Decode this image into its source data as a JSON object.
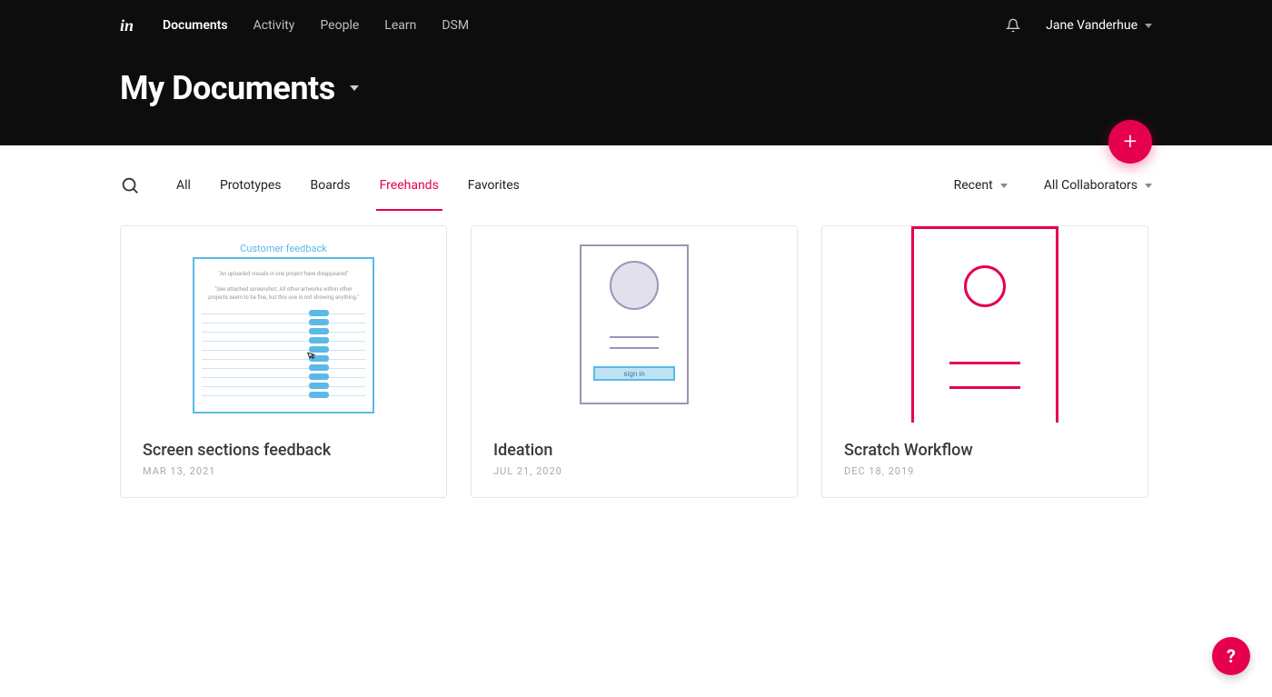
{
  "nav": {
    "links": [
      "Documents",
      "Activity",
      "People",
      "Learn",
      "DSM"
    ],
    "active_index": 0,
    "user_name": "Jane Vanderhue"
  },
  "page_title": "My Documents",
  "tabs": {
    "items": [
      "All",
      "Prototypes",
      "Boards",
      "Freehands",
      "Favorites"
    ],
    "active_index": 3
  },
  "sort_label": "Recent",
  "collab_label": "All Collaborators",
  "cards": [
    {
      "title": "Screen sections feedback",
      "date": "MAR 13, 2021",
      "thumb": {
        "heading": "Customer feedback",
        "quote1": "\"An uploaded visuals in one project have disappeared\"",
        "quote2": "\"See attached screenshot. All other artworks within other projects seem to be fine, but this one is not showing anything.\""
      }
    },
    {
      "title": "Ideation",
      "date": "JUL 21, 2020",
      "thumb": {
        "button_label": "sign in"
      }
    },
    {
      "title": "Scratch Workflow",
      "date": "DEC 18, 2019"
    }
  ],
  "colors": {
    "accent": "#e6004d",
    "sky": "#5bb9e8"
  }
}
